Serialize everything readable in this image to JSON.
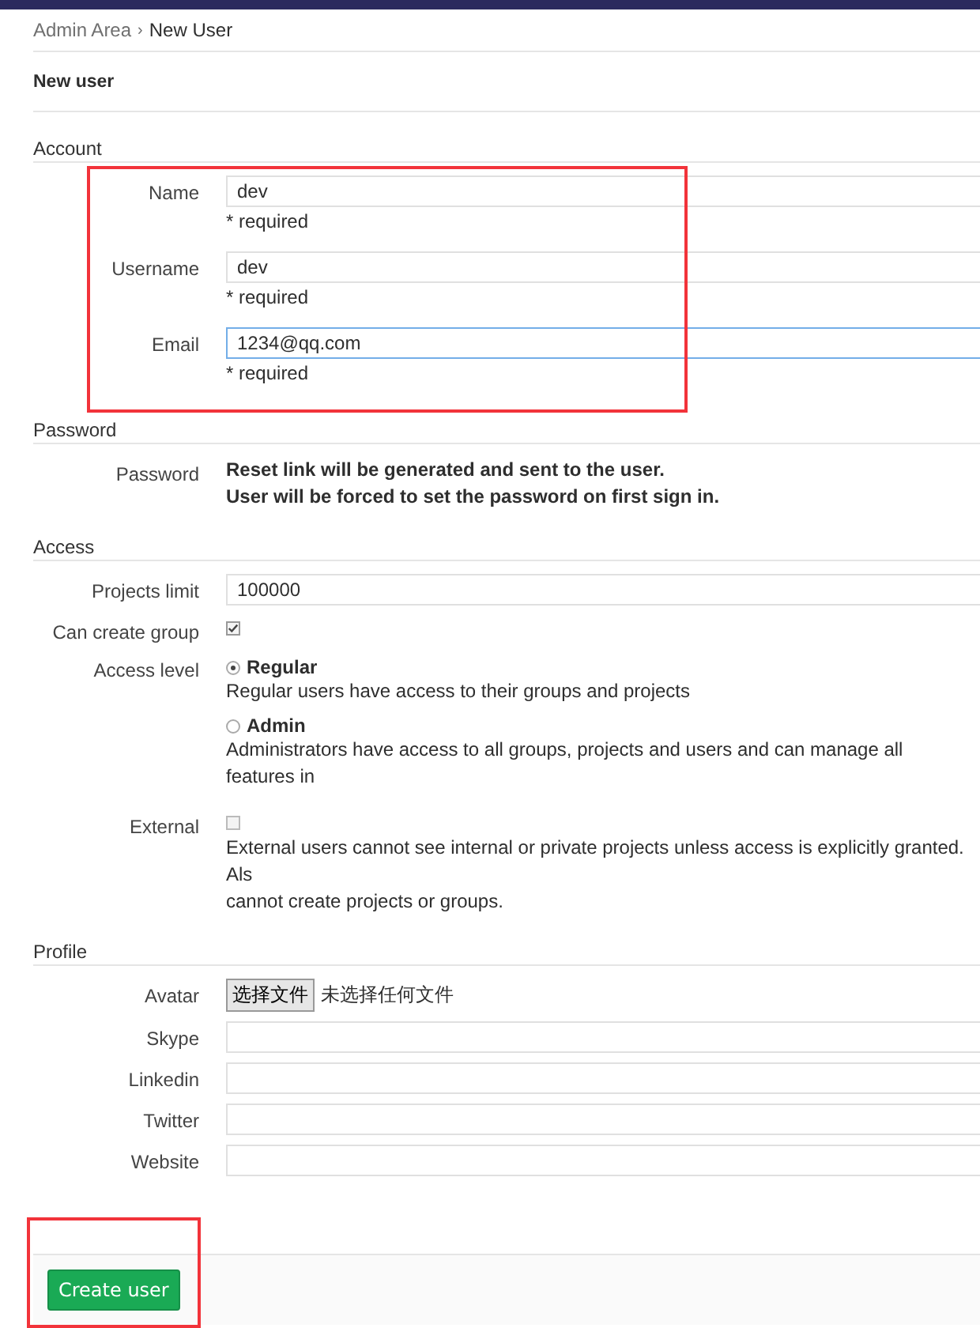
{
  "breadcrumb": {
    "parent": "Admin Area",
    "separator": "›",
    "current": "New User"
  },
  "page_title": "New user",
  "sections": [
    {
      "title": "Account",
      "annotated": true,
      "rows": [
        {
          "kind": "input",
          "label": "Name",
          "value": "dev",
          "focused": false,
          "hint": "* required"
        },
        {
          "kind": "input",
          "label": "Username",
          "value": "dev",
          "focused": false,
          "hint": "* required"
        },
        {
          "kind": "input",
          "label": "Email",
          "value": "1234@qq.com",
          "focused": true,
          "hint": "* required"
        }
      ]
    },
    {
      "title": "Password",
      "annotated": false,
      "rows": [
        {
          "kind": "static",
          "label": "Password",
          "lines": [
            "Reset link will be generated and sent to the user.",
            "User will be forced to set the password on first sign in."
          ]
        }
      ]
    },
    {
      "title": "Access",
      "annotated": false,
      "rows": [
        {
          "kind": "input",
          "label": "Projects limit",
          "value": "100000",
          "focused": false
        },
        {
          "kind": "checkbox",
          "label": "Can create group",
          "checked": true
        },
        {
          "kind": "radio",
          "label": "Access level",
          "options": [
            {
              "label": "Regular",
              "selected": true,
              "description": "Regular users have access to their groups and projects"
            },
            {
              "label": "Admin",
              "selected": false,
              "description": "Administrators have access to all groups, projects and users and can manage all features in"
            }
          ]
        },
        {
          "kind": "checkbox",
          "label": "External",
          "checked": false,
          "lines": [
            "External users cannot see internal or private projects unless access is explicitly granted. Als",
            "cannot create projects or groups."
          ]
        }
      ]
    },
    {
      "title": "Profile",
      "annotated": false,
      "rows": [
        {
          "kind": "file",
          "label": "Avatar",
          "button": "选择文件",
          "status": "未选择任何文件"
        },
        {
          "kind": "input",
          "label": "Skype",
          "value": "",
          "focused": false
        },
        {
          "kind": "input",
          "label": "Linkedin",
          "value": "",
          "focused": false
        },
        {
          "kind": "input",
          "label": "Twitter",
          "value": "",
          "focused": false
        },
        {
          "kind": "input",
          "label": "Website",
          "value": "",
          "focused": false
        }
      ]
    }
  ],
  "footer": {
    "button": "Create user",
    "annotated": true
  }
}
